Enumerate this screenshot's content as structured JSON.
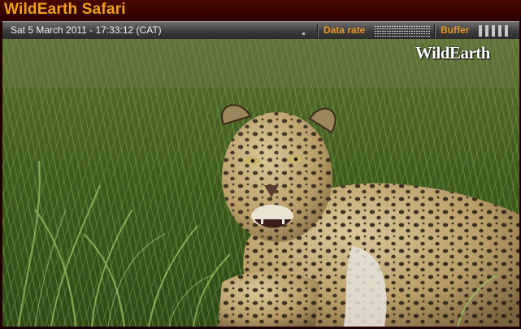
{
  "app": {
    "title": "WildEarth Safari"
  },
  "infobar": {
    "datetime": "Sat 5 March 2011 - 17:33:12 (CAT)",
    "data_rate_label": "Data rate",
    "buffer_label": "Buffer",
    "buffer_level_bars": 5
  },
  "video": {
    "watermark": "WildEarth",
    "subject": "leopard-in-grass-image"
  },
  "colors": {
    "brand_orange": "#f0a21a",
    "title_bg": "#3a0400",
    "info_bar": "#4a4a4a"
  }
}
